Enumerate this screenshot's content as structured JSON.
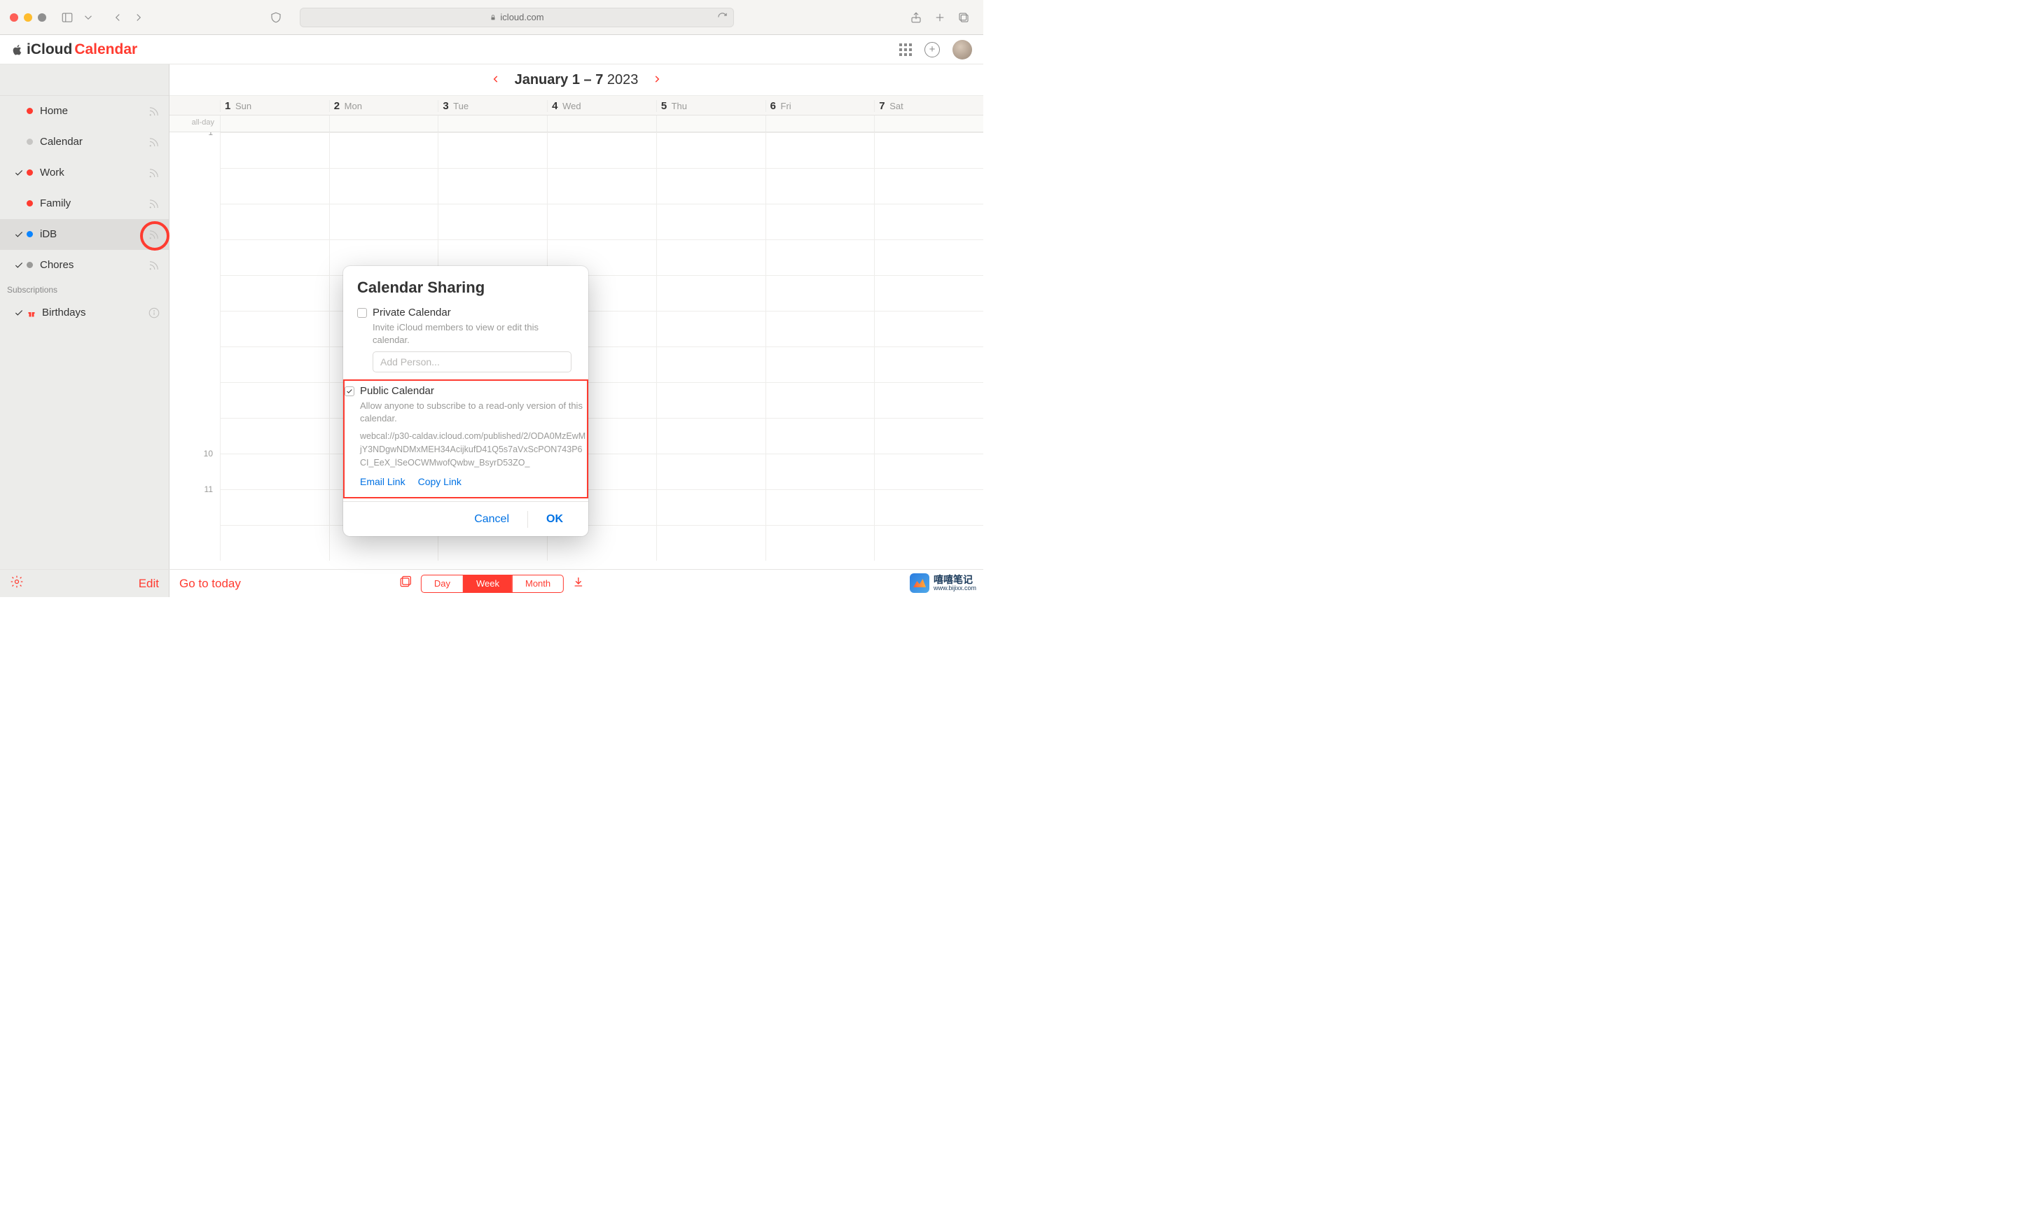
{
  "browser": {
    "domain": "icloud.com"
  },
  "brand": {
    "prefix": "iCloud",
    "app": "Calendar"
  },
  "week": {
    "range_bold": "January 1 – 7",
    "range_year": " 2023"
  },
  "sidebar": {
    "items": [
      {
        "label": "Home",
        "color": "#ff3b30",
        "checked": false
      },
      {
        "label": "Calendar",
        "color": "#c7c6c4",
        "checked": false
      },
      {
        "label": "Work",
        "color": "#ff3b30",
        "checked": true
      },
      {
        "label": "Family",
        "color": "#ff3b30",
        "checked": false
      },
      {
        "label": "iDB",
        "color": "#0a84ff",
        "checked": true,
        "selected": true
      },
      {
        "label": "Chores",
        "color": "#9a9a98",
        "checked": true
      }
    ],
    "subs_header": "Subscriptions",
    "birthdays": {
      "label": "Birthdays",
      "checked": true
    }
  },
  "days": [
    {
      "n": "1",
      "d": "Sun"
    },
    {
      "n": "2",
      "d": "Mon"
    },
    {
      "n": "3",
      "d": "Tue"
    },
    {
      "n": "4",
      "d": "Wed"
    },
    {
      "n": "5",
      "d": "Thu"
    },
    {
      "n": "6",
      "d": "Fri"
    },
    {
      "n": "7",
      "d": "Sat"
    }
  ],
  "allday_label": "all-day",
  "hours": [
    "1",
    "",
    "",
    "",
    "",
    "",
    "",
    "",
    "",
    "10",
    "11",
    ""
  ],
  "popover": {
    "title": "Calendar Sharing",
    "private_label": "Private Calendar",
    "private_desc": "Invite iCloud members to view or edit this calendar.",
    "add_placeholder": "Add Person...",
    "public_label": "Public Calendar",
    "public_desc": "Allow anyone to subscribe to a read-only version of this calendar.",
    "url": "webcal://p30-caldav.icloud.com/published/2/ODA0MzEwMjY3NDgwNDMxMEH34AcijkufD41Q5s7aVxScPON743P6CI_EeX_lSeOCWMwofQwbw_BsyrD53ZO_",
    "email_link": "Email Link",
    "copy_link": "Copy Link",
    "cancel": "Cancel",
    "ok": "OK"
  },
  "bottom": {
    "edit": "Edit",
    "gotoday": "Go to today",
    "seg": {
      "day": "Day",
      "week": "Week",
      "month": "Month"
    }
  },
  "watermark": {
    "name": "嘻嘻笔记",
    "url": "www.bijixx.com"
  }
}
